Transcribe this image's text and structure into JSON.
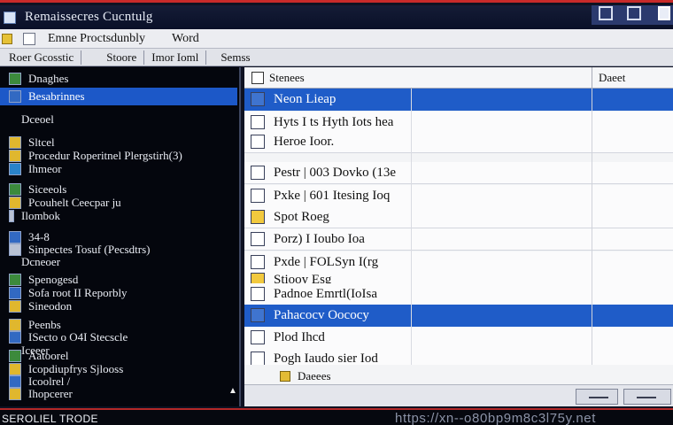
{
  "window": {
    "title": "Remaissecres Cucntulg",
    "colors": {
      "accent": "#1f5cc8",
      "frame": "#c72a2a",
      "sidebar_bg": "#04060d"
    }
  },
  "menu": {
    "items": [
      "Emne Proctsdunbly",
      "Word"
    ]
  },
  "toolbar": {
    "items": [
      "Roer Gcosstic",
      "Stoore",
      "Imor Ioml",
      "Semss"
    ]
  },
  "sidebar": {
    "items": [
      {
        "label": "Dnaghes",
        "icon": "folder-green-icon"
      },
      {
        "label": "Besabrinnes",
        "icon": "folder-blue-icon",
        "selected": true
      },
      {
        "label": "Dceoel",
        "icon": ""
      },
      {
        "label": "Sltcel",
        "icon": "folder-yellow-icon"
      },
      {
        "label": "Procedur Roperitnel Plergstirh(3)",
        "icon": "folder-yellow-icon"
      },
      {
        "label": "Ihmeor",
        "icon": "net-icon"
      },
      {
        "label": "Siceeols",
        "icon": "folder-green-icon"
      },
      {
        "label": "Pcouhelt Ceecpar ju",
        "icon": "folder-yellow-icon"
      },
      {
        "label": "Ilombok",
        "icon": "drive-icon"
      },
      {
        "label": "34-8",
        "icon": "folder-blue-icon"
      },
      {
        "label": "Sinpectes Tosuf (Pecsdtrs)",
        "icon": "drive-icon"
      },
      {
        "label": "Dcneoer",
        "icon": ""
      },
      {
        "label": "Spenogesd",
        "icon": "folder-green-icon"
      },
      {
        "label": "Sofa root II Reporbly",
        "icon": "folder-blue-icon"
      },
      {
        "label": "Sineodon",
        "icon": "folder-yellow-icon"
      },
      {
        "label": "Peenbs",
        "icon": "folder-yellow-icon"
      },
      {
        "label": "ISecto o O4I Stecscle",
        "icon": "folder-blue-icon"
      },
      {
        "label": "Iceeer",
        "icon": ""
      },
      {
        "label": "Aatoorel",
        "icon": "folder-green-icon"
      },
      {
        "label": "Icopdiupfrys Sjlooss",
        "icon": "folder-yellow-icon"
      },
      {
        "label": "Icoolrel /",
        "icon": "folder-blue-icon"
      },
      {
        "label": "Ihopcerer",
        "icon": "folder-yellow-icon"
      }
    ]
  },
  "list": {
    "header": {
      "name": "Stenees",
      "date": "Daeet"
    },
    "rows": [
      {
        "name": "Neon Lieap",
        "icon": "folder-blue-icon",
        "selected": true
      },
      {
        "name": "Hyts I ts Hyth Iots hea",
        "icon": "doc-icon"
      },
      {
        "name": "Heroe Ioor.",
        "icon": "doc-icon"
      },
      {
        "name": "Pestr | 003 Dovko (13e",
        "icon": "doc-icon"
      },
      {
        "name": "Pxke | 601 Itesing Ioq",
        "icon": "doc-icon"
      },
      {
        "name": "Spot Roeg",
        "icon": "yellow-icon"
      },
      {
        "name": "Porz) I Ioubo Ioa",
        "icon": "doc-icon"
      },
      {
        "name": "Pxde | FOLSyn I(rg",
        "icon": "doc-icon"
      },
      {
        "name": "Stiooy Esg",
        "icon": "yellow-icon"
      },
      {
        "name": "Padnoe Emrtl(IoIsa",
        "icon": "doc-icon"
      },
      {
        "name": "Pahacocv Oococy",
        "icon": "folder-blue-icon",
        "selected": true
      },
      {
        "name": "Plod Ihcd",
        "icon": "doc-icon"
      },
      {
        "name": "Pogh Iaudo sier Iod",
        "icon": "doc-icon"
      }
    ],
    "footer": {
      "label": "Daeees"
    }
  },
  "status": {
    "left": "SEROLIEL TRODE",
    "url": "https://xn--o80bp9m8c3l75y.net"
  }
}
